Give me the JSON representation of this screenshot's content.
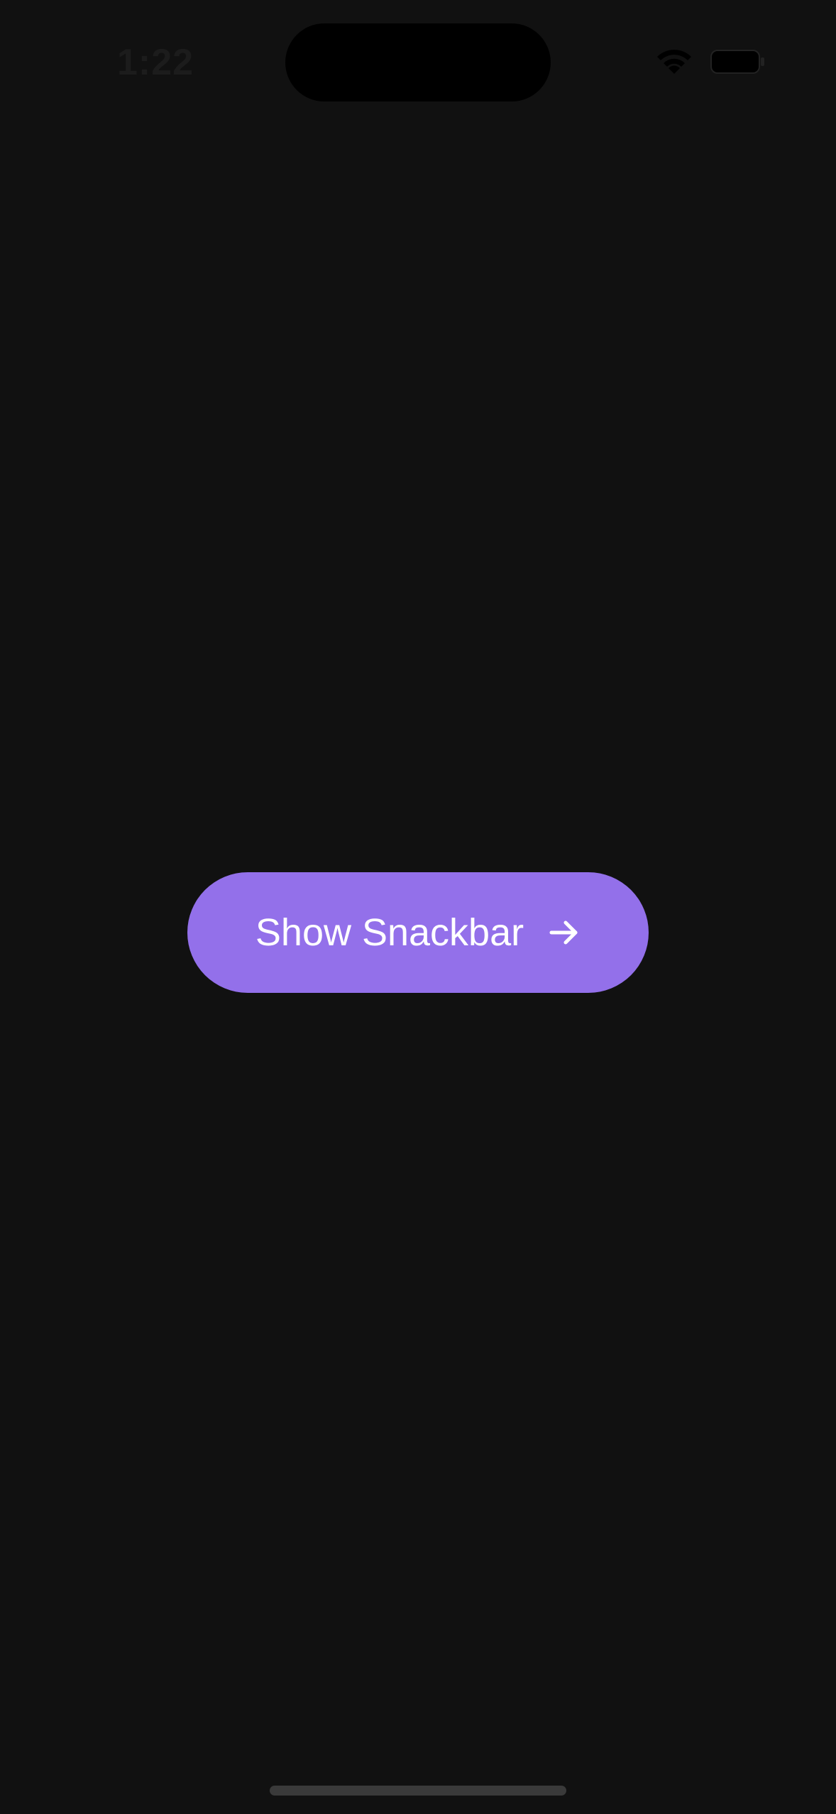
{
  "status_bar": {
    "time": "1:22",
    "wifi_icon": "wifi-icon",
    "battery_icon": "battery-icon"
  },
  "main": {
    "button_label": "Show Snackbar",
    "button_icon": "arrow-right-icon"
  },
  "colors": {
    "background": "#111111",
    "button": "#9370ea",
    "button_text": "#ffffff"
  }
}
